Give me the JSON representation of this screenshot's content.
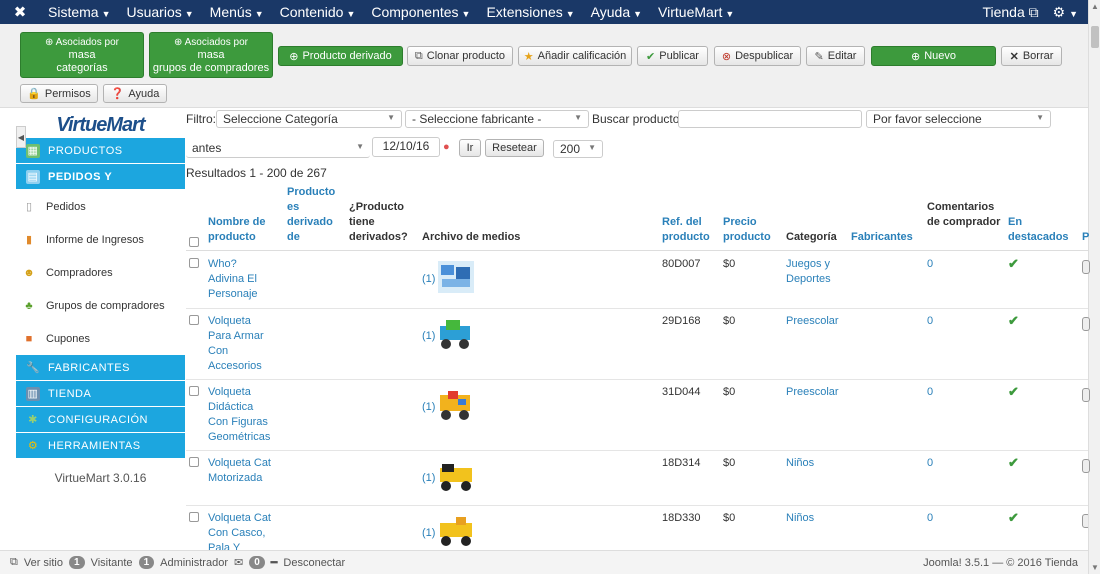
{
  "topbar": {
    "menu": [
      "Sistema",
      "Usuarios",
      "Menús",
      "Contenido",
      "Componentes",
      "Extensiones",
      "Ayuda",
      "VirtueMart"
    ],
    "store_label": "Tienda",
    "accent": "#1a3867"
  },
  "toolbar": {
    "btn_asociados_cat": [
      "Asociados por",
      "masa",
      "categorías"
    ],
    "btn_asociados_grp": [
      "Asociados por",
      "masa",
      "grupos de compradores"
    ],
    "btn_derivado": "Producto derivado",
    "btn_clonar": "Clonar producto",
    "btn_calificacion": "Añadir calificación",
    "btn_publicar": "Publicar",
    "btn_despublicar": "Despublicar",
    "btn_editar": "Editar",
    "btn_nuevo": "Nuevo",
    "btn_borrar": "Borrar",
    "btn_permisos": "Permisos",
    "btn_ayuda": "Ayuda"
  },
  "sidebar": {
    "logo": "VirtueMart",
    "productos": "PRODUCTOS",
    "pedidos_y": "PEDIDOS Y",
    "pedidos": "Pedidos",
    "informe": "Informe de Ingresos",
    "compradores": "Compradores",
    "grupos": "Grupos de compradores",
    "cupones": "Cupones",
    "fabricantes": "FABRICANTES",
    "tienda": "TIENDA",
    "configuracion": "CONFIGURACIÓN",
    "herramientas": "HERRAMIENTAS",
    "version": "VirtueMart 3.0.16"
  },
  "filters": {
    "filtro_label": "Filtro:",
    "categoria": "Seleccione Categoría",
    "fabricante": "- Seleccione fabricante -",
    "buscar_label": "Buscar producto",
    "buscar_value": "",
    "por_favor": "Por favor seleccione",
    "antes": "antes",
    "fecha": "12/10/16",
    "ir": "Ir",
    "resetear": "Resetear",
    "limite": "200",
    "resultados": "Resultados 1 - 200 de 267"
  },
  "table": {
    "h_nombre": "Nombre de producto",
    "h_derivado": "Producto es derivado de",
    "h_tiene": "¿Producto tiene derivados?",
    "h_archivo": "Archivo de medios",
    "h_ref": "Ref. del producto",
    "h_precio": "Precio producto",
    "h_categoria": "Categoría",
    "h_fabricantes": "Fabricantes",
    "h_comentarios": "Comentarios de comprador",
    "h_destacados": "En destacados",
    "h_next": "P",
    "rows": [
      {
        "name": "Who? Adivina El Personaje",
        "media": "(1)",
        "ref": "80D007",
        "price": "$0",
        "category": "Juegos y Deportes",
        "comments": "0",
        "featured": "✔"
      },
      {
        "name": "Volqueta Para Armar Con Accesorios",
        "media": "(1)",
        "ref": "29D168",
        "price": "$0",
        "category": "Preescolar",
        "comments": "0",
        "featured": "✔"
      },
      {
        "name": "Volqueta Didáctica Con Figuras Geométricas",
        "media": "(1)",
        "ref": "31D044",
        "price": "$0",
        "category": "Preescolar",
        "comments": "0",
        "featured": "✔"
      },
      {
        "name": "Volqueta Cat Motorizada",
        "media": "(1)",
        "ref": "18D314",
        "price": "$0",
        "category": "Niños",
        "comments": "0",
        "featured": "✔"
      },
      {
        "name": "Volqueta Cat Con Casco, Pala Y",
        "media": "(1)",
        "ref": "18D330",
        "price": "$0",
        "category": "Niños",
        "comments": "0",
        "featured": "✔"
      }
    ]
  },
  "footer": {
    "ver_sitio": "Ver sitio",
    "visitante_count": "1",
    "visitante": "Visitante",
    "admin_count": "1",
    "administrador": "Administrador",
    "msg_count": "0",
    "desconectar": "Desconectar",
    "version": "Joomla! 3.5.1 — © 2016 Tienda"
  }
}
